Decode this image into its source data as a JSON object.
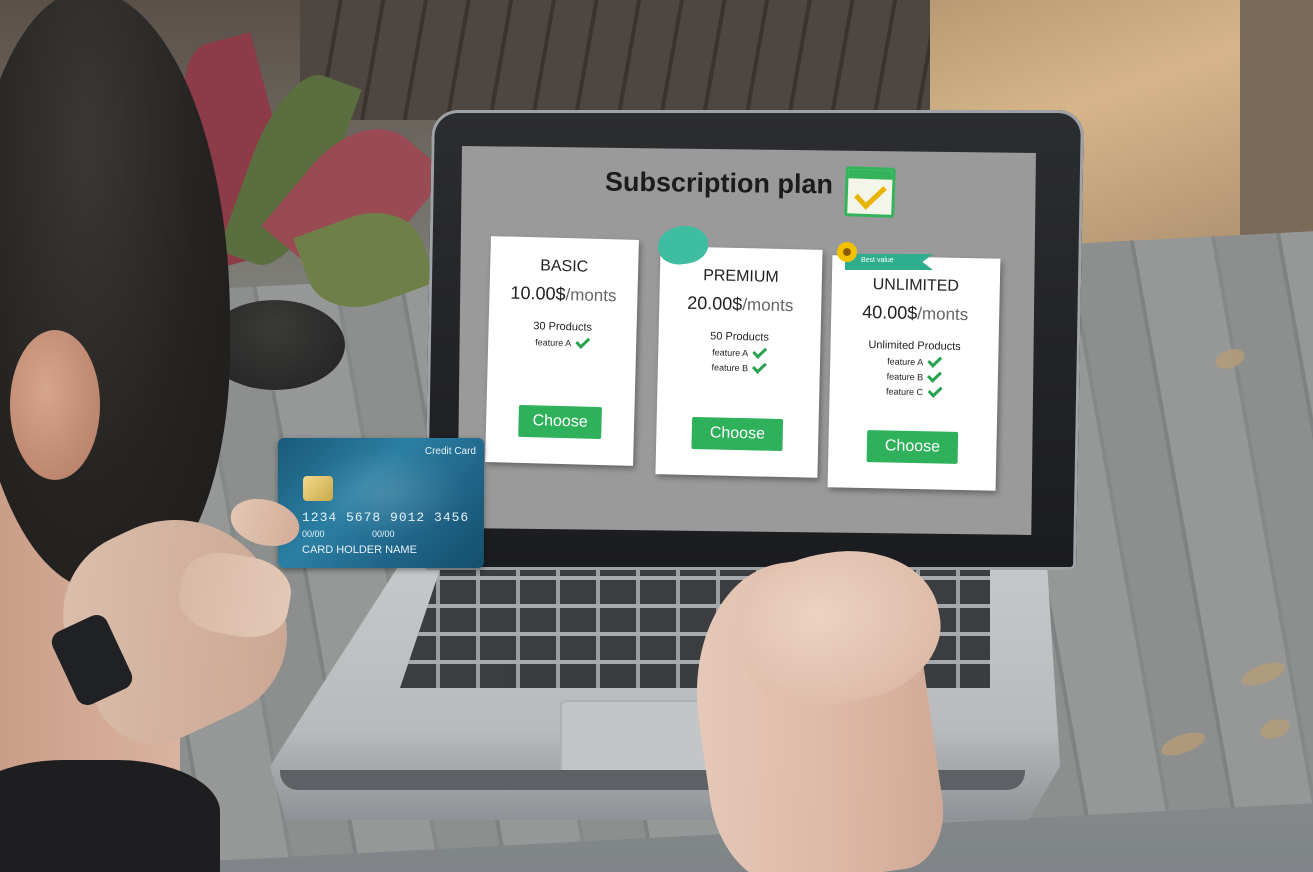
{
  "scene": {
    "screen": {
      "title": "Subscription plan",
      "title_icon": "calendar-check-icon",
      "plans": [
        {
          "name": "BASIC",
          "price": "10.00$",
          "period": "/monts",
          "products": "30 Products",
          "features": [
            "feature A"
          ],
          "button": "Choose"
        },
        {
          "name": "PREMIUM",
          "price": "20.00$",
          "period": "/monts",
          "products": "50 Products",
          "features": [
            "feature A",
            "feature B"
          ],
          "button": "Choose"
        },
        {
          "name": "UNLIMITED",
          "price": "40.00$",
          "period": "/monts",
          "products": "Unlimited Products",
          "features": [
            "feature A",
            "feature B",
            "feature C"
          ],
          "button": "Choose",
          "badge": "Best value"
        }
      ]
    },
    "credit_card": {
      "label": "Credit Card",
      "number": "1234 5678 9012 3456",
      "date_from": "00/00",
      "date_to": "00/00",
      "holder": "CARD HOLDER NAME"
    }
  },
  "colors": {
    "accent_green": "#2fb05b",
    "check_green": "#27a34e",
    "card_blue": "#1f6488"
  }
}
